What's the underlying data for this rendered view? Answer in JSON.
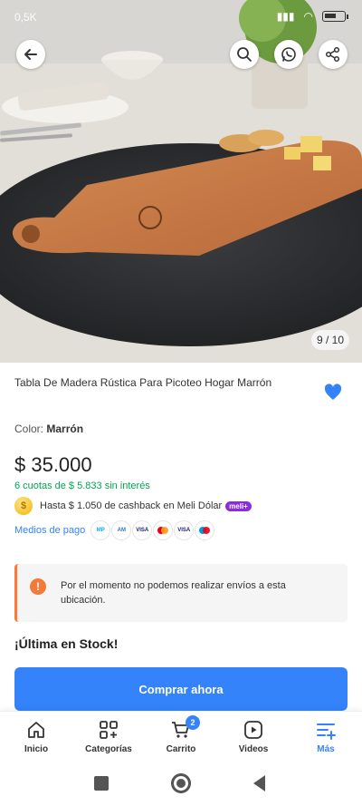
{
  "statusbar": {
    "left_text": "0,5K",
    "battery_level": "5"
  },
  "gallery": {
    "counter": "9 / 10"
  },
  "product": {
    "title": "Tabla De Madera Rústica Para Picoteo Hogar Marrón",
    "color_label": "Color:",
    "color_value": "Marrón",
    "price": "$ 35.000",
    "installments": "6 cuotas de $ 5.833 sin interés",
    "cashback": "Hasta $ 1.050  de cashback en Meli Dólar",
    "meli_badge": "meli+",
    "payments_label": "Medios de pago",
    "payment_methods": [
      "Mercado Pago",
      "Amex",
      "VISA",
      "Mastercard",
      "VISA Débito",
      "Maestro"
    ],
    "notice": "Por el momento no podemos realizar envíos a esta ubicación.",
    "stock": "¡Última en Stock!",
    "buy_label": "Comprar ahora"
  },
  "tabs": [
    {
      "label": "Inicio",
      "icon": "home-icon"
    },
    {
      "label": "Categorías",
      "icon": "grid-plus-icon"
    },
    {
      "label": "Carrito",
      "icon": "cart-icon",
      "badge": "2"
    },
    {
      "label": "Videos",
      "icon": "play-icon"
    },
    {
      "label": "Más",
      "icon": "menu-plus-icon",
      "active": true
    }
  ],
  "colors": {
    "accent": "#3483fa",
    "success": "#00a650",
    "warning": "#f37a3b"
  }
}
